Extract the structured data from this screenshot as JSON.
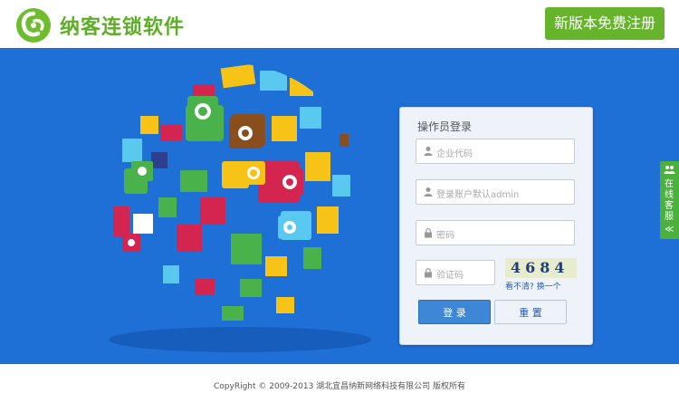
{
  "header": {
    "brand_name": "纳客连锁软件",
    "register_label": "新版本免费注册"
  },
  "login": {
    "title": "操作员登录",
    "company_code_placeholder": "企业代码",
    "account_placeholder": "登录账户默认admin",
    "password_placeholder": "密码",
    "captcha_placeholder": "验证码",
    "captcha_text": "4684",
    "refresh_captcha_label": "看不清? 换一个",
    "login_label": "登 录",
    "reset_label": "重 置"
  },
  "service": {
    "label": "在线客服",
    "collapse_glyph": "≪"
  },
  "footer": {
    "copyright": "CopyRight © 2009-2013 湖北宜昌纳新网络科技有限公司 版权所有"
  },
  "colors": {
    "brand_green": "#5fae27",
    "hero_blue": "#1e6fd6",
    "login_button": "#3d87d6"
  }
}
